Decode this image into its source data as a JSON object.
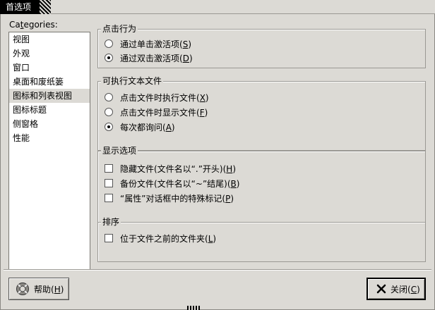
{
  "window": {
    "title": "首选项"
  },
  "sidebar": {
    "label_pre": "Ca",
    "label_mnemonic": "t",
    "label_post": "egories:",
    "items": [
      {
        "label": "视图"
      },
      {
        "label": "外观"
      },
      {
        "label": "窗口"
      },
      {
        "label": "桌面和废纸篓"
      },
      {
        "label": "图标和列表视图"
      },
      {
        "label": "图标标题"
      },
      {
        "label": "侧窗格"
      },
      {
        "label": "性能"
      }
    ],
    "selected_index": 4
  },
  "click_behavior": {
    "title": "点击行为",
    "options": [
      {
        "pre": "通过单击激活项(",
        "key": "S",
        "post": ")",
        "checked": false
      },
      {
        "pre": "通过双击激活项(",
        "key": "D",
        "post": ")",
        "checked": true
      }
    ]
  },
  "executable": {
    "title": "可执行文本文件",
    "options": [
      {
        "pre": "点击文件时执行文件(",
        "key": "X",
        "post": ")",
        "checked": false
      },
      {
        "pre": "点击文件时显示文件(",
        "key": "F",
        "post": ")",
        "checked": false
      },
      {
        "pre": "每次都询问(",
        "key": "A",
        "post": ")",
        "checked": true
      }
    ]
  },
  "display": {
    "title": "显示选项",
    "options": [
      {
        "pre": "隐藏文件(文件名以“.”开头)(",
        "key": "H",
        "post": ")",
        "checked": false
      },
      {
        "pre": "备份文件(文件名以“~”结尾)(",
        "key": "B",
        "post": ")",
        "checked": false
      },
      {
        "pre": "“属性”对话框中的特殊标记(",
        "key": "P",
        "post": ")",
        "checked": false
      }
    ]
  },
  "sort": {
    "title": "排序",
    "options": [
      {
        "pre": "位于文件之前的文件夹(",
        "key": "L",
        "post": ")",
        "checked": false
      }
    ]
  },
  "buttons": {
    "help": {
      "pre": "帮助(",
      "key": "H",
      "post": ")",
      "icon": "help-lifebuoy-icon"
    },
    "close": {
      "pre": "关闭(",
      "key": "C",
      "post": ")",
      "icon": "close-x-icon"
    }
  }
}
